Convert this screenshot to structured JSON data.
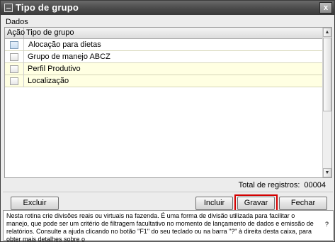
{
  "window": {
    "title": "Tipo de grupo",
    "close_glyph": "x"
  },
  "section": {
    "label": "Dados"
  },
  "grid": {
    "columns": [
      "Ação",
      "Tipo de grupo"
    ],
    "rows": [
      {
        "label": "Alocação para dietas",
        "checked": false
      },
      {
        "label": "Grupo de manejo ABCZ",
        "checked": false
      },
      {
        "label": "Perfil Produtivo",
        "checked": false
      },
      {
        "label": "Localização",
        "checked": false
      }
    ]
  },
  "footer": {
    "total_label": "Total de registros:",
    "total_value": "00004"
  },
  "buttons": {
    "excluir": "Excluir",
    "incluir": "Incluir",
    "gravar": "Gravar",
    "fechar": "Fechar"
  },
  "help": {
    "text": "Nesta rotina crie divisões reais ou virtuais na fazenda. É uma forma de divisão utilizada para facilitar o manejo, que pode ser um critério de filtragem facultativo no momento de lançamento de dados e emissão de relatórios. Consulte a ajuda clicando no botão \"F1\" do seu teclado ou na barra \"?\" à direita desta caixa, para obter mais detalhes sobre o",
    "question_mark": "?"
  },
  "colors": {
    "highlight": "#d40000",
    "row_alt": "#ffffe2",
    "titlebar": "#4a4a4a"
  },
  "icons": [
    "window-icon",
    "close-icon",
    "scroll-up-icon",
    "scroll-down-icon"
  ]
}
